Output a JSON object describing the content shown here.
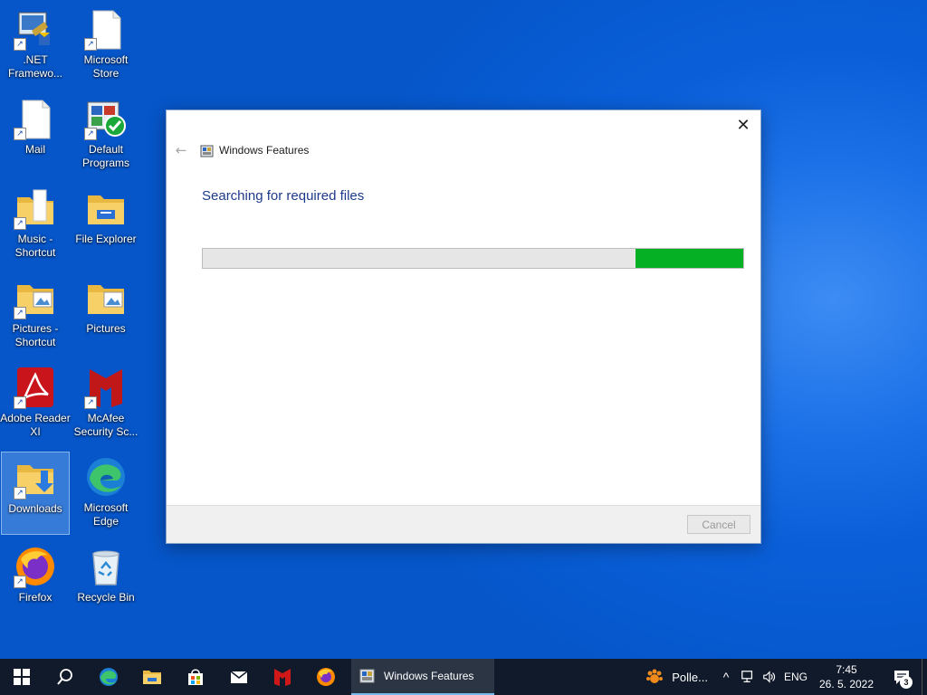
{
  "desktop": {
    "icons": [
      {
        "label": ".NET Framewo..."
      },
      {
        "label": "Microsoft Store"
      },
      {
        "label": "Mail"
      },
      {
        "label": "Default Programs"
      },
      {
        "label": "Music - Shortcut"
      },
      {
        "label": "File Explorer"
      },
      {
        "label": "Pictures - Shortcut"
      },
      {
        "label": "Pictures"
      },
      {
        "label": "Adobe Reader XI"
      },
      {
        "label": "McAfee Security Sc..."
      },
      {
        "label": "Downloads"
      },
      {
        "label": "Microsoft Edge"
      },
      {
        "label": "Firefox"
      },
      {
        "label": "Recycle Bin"
      }
    ]
  },
  "dialog": {
    "title": "Windows Features",
    "heading": "Searching for required files",
    "progress_fraction": 0.2,
    "cancel_label": "Cancel",
    "close_glyph": "✕",
    "back_glyph": "←"
  },
  "taskbar": {
    "pinned": [
      "windows-start-icon",
      "search-icon",
      "edge-icon",
      "file-explorer-icon",
      "store-icon",
      "mail-icon",
      "mcafee-icon",
      "firefox-icon"
    ],
    "active_app": "Windows Features"
  },
  "tray": {
    "weather_text": "Polle...",
    "chevron": "^",
    "language": "ENG",
    "time": "7:45",
    "date": "26. 5. 2022",
    "notification_count": "3"
  },
  "colors": {
    "progress_fill": "#06b025",
    "heading": "#1e3a8a",
    "taskbar": "#101a2a"
  }
}
